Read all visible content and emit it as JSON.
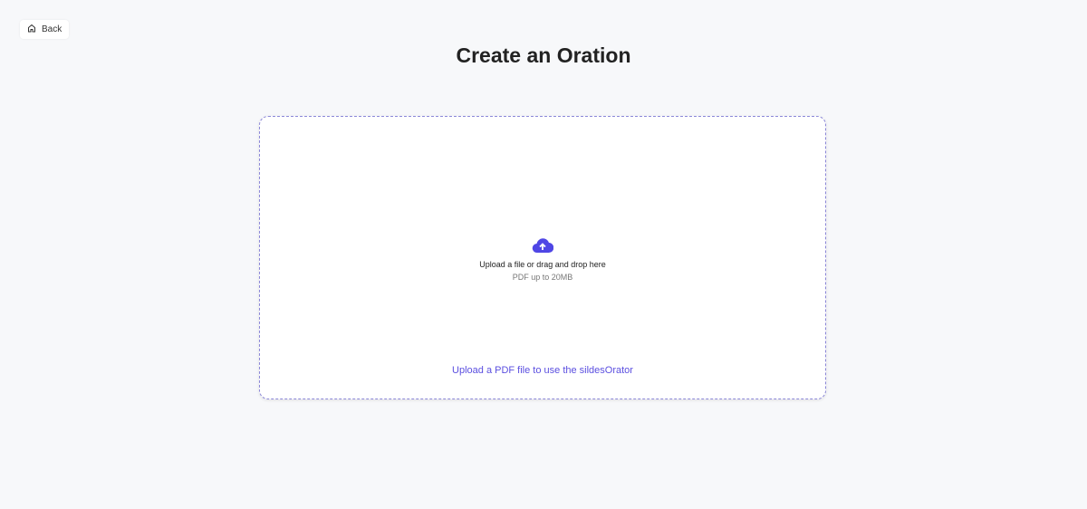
{
  "back_label": "Back",
  "title": "Create an Oration",
  "upload": {
    "primary": "Upload a file or drag and drop here",
    "secondary": "PDF up to 20MB",
    "hint": "Upload a PDF file to use the sildesOrator"
  },
  "colors": {
    "accent": "#4f46e5"
  }
}
